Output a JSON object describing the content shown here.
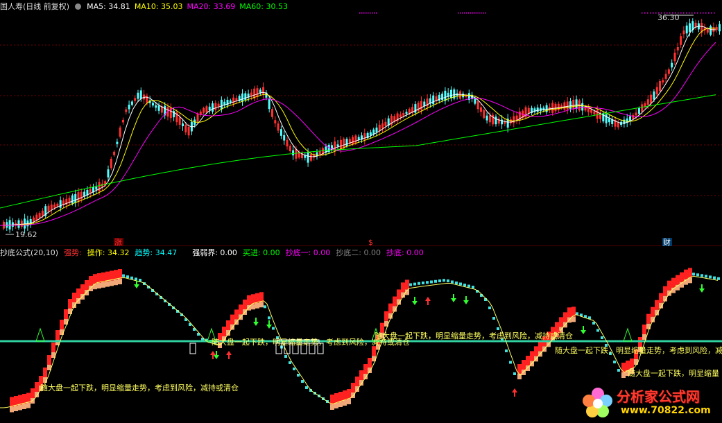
{
  "top_legend": {
    "stock_title": "国人寿(日线 前复权)",
    "ma5": {
      "label": "MA5: 34.81",
      "color": "#ffffff"
    },
    "ma10": {
      "label": "MA10: 35.03",
      "color": "#ffff00"
    },
    "ma20": {
      "label": "MA20: 33.69",
      "color": "#ff00ff"
    },
    "ma60": {
      "label": "MA60: 30.53",
      "color": "#00ff00"
    }
  },
  "price_panel": {
    "high_label": "36.30",
    "low_label": "19.62",
    "markers": [
      {
        "text": "涨",
        "color": "#ff3030"
      },
      {
        "text": "$",
        "color": "#ff3030"
      },
      {
        "text": "财",
        "color": "#ffffff"
      }
    ]
  },
  "indicator_legend": {
    "name": "抄底公式(20,10)",
    "items": [
      {
        "text": "强势:",
        "color": "#ff3030"
      },
      {
        "text": "操作: 34.32",
        "color": "#ffff00"
      },
      {
        "text": "趋势: 34.47",
        "color": "#00ffff"
      },
      {
        "text": "强弱界: 0.00",
        "color": "#ffffff"
      },
      {
        "text": "买进: 0.00",
        "color": "#00ff00"
      },
      {
        "text": "抄底一: 0.00",
        "color": "#ff00ff"
      },
      {
        "text": "抄底二: 0.00",
        "color": "#808080"
      },
      {
        "text": "抄底: 0.00",
        "color": "#ff00ff"
      }
    ]
  },
  "annotations": [
    "随大盘一起下跌，明显缩量走势，考虑到风险，减持或清仓",
    "随大盘一起下跌，明显缩量走势，考虑到风险，减持或清仓",
    "随大盘一起下跌，明显缩量走势，考虑到风险，减持或清仓",
    "随大盘一起下跌，明显缩量走势，考虑到风险，减持或清仓",
    "随大盘一起下跌，明显缩量"
  ],
  "watermark": {
    "brand": "分析家公式网",
    "url": "www.70822.com"
  },
  "colors": {
    "up": "#ff3030",
    "down": "#54ffff",
    "grid": "#7a0000",
    "strong": "#ff2020",
    "tan": "#f0a878",
    "trend": "#40e0e0",
    "operate": "#ffff60",
    "midline": "#30d0a0"
  }
}
